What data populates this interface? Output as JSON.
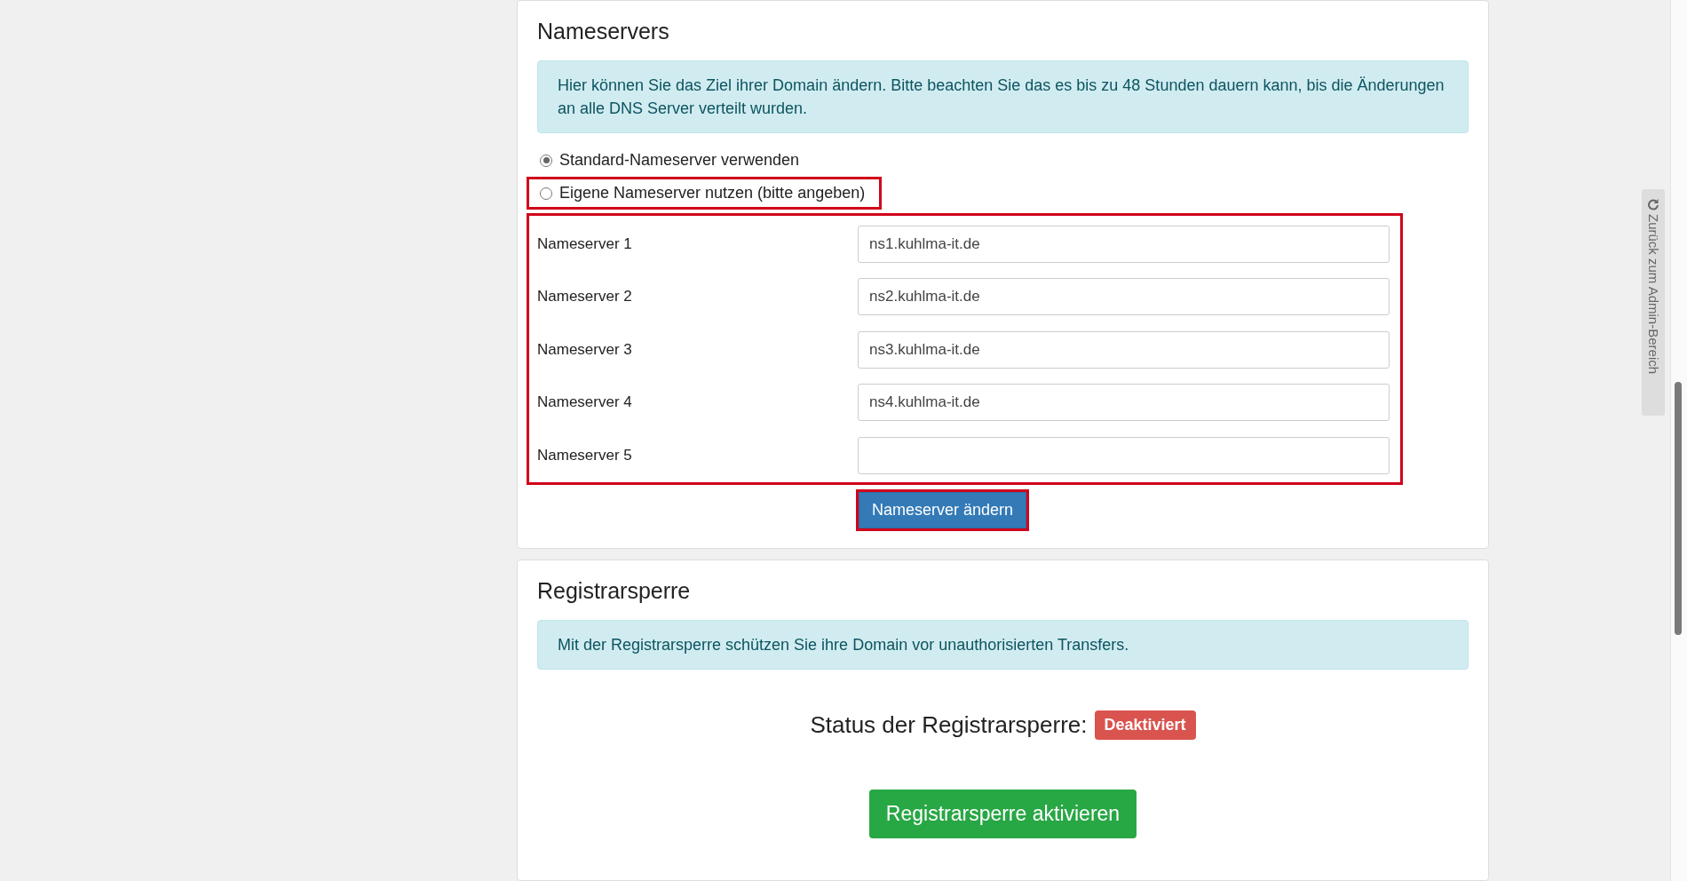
{
  "nameservers": {
    "title": "Nameservers",
    "info": "Hier können Sie das Ziel ihrer Domain ändern. Bitte beachten Sie das es bis zu 48 Stunden dauern kann, bis die Änderungen an alle DNS Server verteilt wurden.",
    "options": [
      {
        "label": "Standard-Nameserver verwenden",
        "selected": true,
        "highlighted": false
      },
      {
        "label": "Eigene Nameserver nutzen (bitte angeben)",
        "selected": false,
        "highlighted": true
      }
    ],
    "fields_highlighted": true,
    "fields": [
      {
        "label": "Nameserver 1",
        "value": "ns1.kuhlma-it.de"
      },
      {
        "label": "Nameserver 2",
        "value": "ns2.kuhlma-it.de"
      },
      {
        "label": "Nameserver 3",
        "value": "ns3.kuhlma-it.de"
      },
      {
        "label": "Nameserver 4",
        "value": "ns4.kuhlma-it.de"
      },
      {
        "label": "Nameserver 5"
      }
    ],
    "button": {
      "label": "Nameserver ändern",
      "highlighted": true
    }
  },
  "registrar_lock": {
    "title": "Registrarsperre",
    "info": "Mit der Registrarsperre schützen Sie ihre Domain vor unauthorisierten Transfers.",
    "status_label": "Status der Registrarsperre:",
    "status": {
      "label": "Deaktiviert",
      "color": "#d9534f"
    },
    "button": "Registrarsperre aktivieren"
  },
  "side_tab": "Zurück zum Admin-Bereich"
}
